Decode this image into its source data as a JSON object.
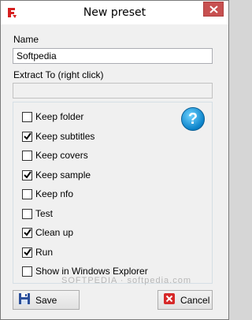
{
  "window": {
    "title": "New preset"
  },
  "form": {
    "name_label": "Name",
    "name_value": "Softpedia",
    "extract_label": "Extract To (right click)",
    "extract_value": ""
  },
  "options": [
    {
      "label": "Keep folder",
      "checked": false
    },
    {
      "label": "Keep subtitles",
      "checked": true
    },
    {
      "label": "Keep covers",
      "checked": false
    },
    {
      "label": "Keep sample",
      "checked": true
    },
    {
      "label": "Keep nfo",
      "checked": false
    },
    {
      "label": "Test",
      "checked": false
    },
    {
      "label": "Clean up",
      "checked": true
    },
    {
      "label": "Run",
      "checked": true
    },
    {
      "label": "Show in Windows Explorer",
      "checked": false
    }
  ],
  "help": {
    "glyph": "?"
  },
  "buttons": {
    "save_label": "Save",
    "cancel_label": "Cancel"
  },
  "watermark": "SOFTPEDIA · softpedia.com"
}
